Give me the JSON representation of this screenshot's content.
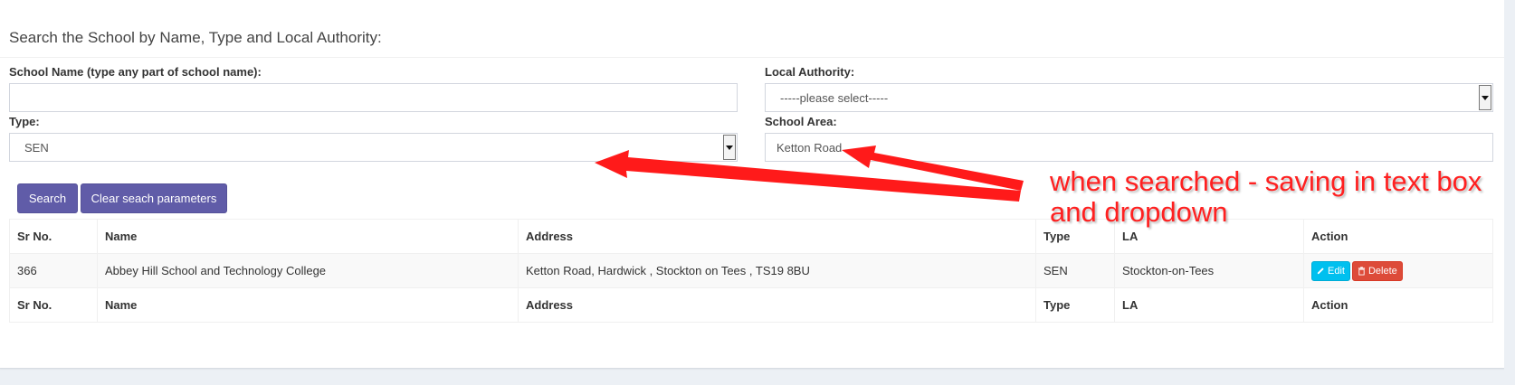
{
  "panel": {
    "title": "Search the School by Name, Type and Local Authority:"
  },
  "form": {
    "school_name": {
      "label": "School Name (type any part of school name):",
      "value": "",
      "placeholder": ""
    },
    "local_authority": {
      "label": "Local Authority:",
      "selected": "-----please select-----"
    },
    "type": {
      "label": "Type:",
      "selected": "SEN"
    },
    "school_area": {
      "label": "School Area:",
      "value": "Ketton Road"
    }
  },
  "buttons": {
    "search": "Search",
    "clear": "Clear seach parameters"
  },
  "table": {
    "headers": [
      "Sr No.",
      "Name",
      "Address",
      "Type",
      "LA",
      "Action"
    ],
    "rows": [
      {
        "sr_no": "366",
        "name": "Abbey Hill School and Technology College",
        "address": "Ketton Road, Hardwick , Stockton on Tees , TS19 8BU",
        "type": "SEN",
        "la": "Stockton-on-Tees",
        "edit": "Edit",
        "delete": "Delete"
      }
    ]
  },
  "annotation": {
    "text": "when searched - saving in text box and dropdown",
    "color": "#ff2020"
  },
  "colors": {
    "primary_button": "#605ca8",
    "edit_button": "#00c0ef",
    "delete_button": "#dd4b39"
  },
  "icons": {
    "edit": "pencil-icon",
    "delete": "trash-icon"
  }
}
